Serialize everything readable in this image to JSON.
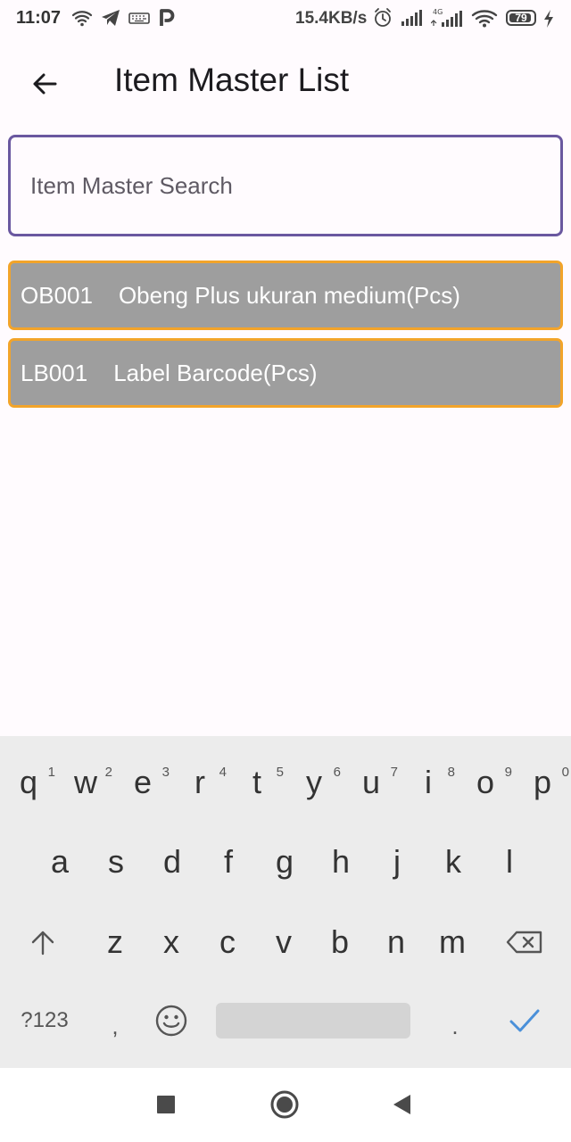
{
  "status_bar": {
    "time": "11:07",
    "network_speed": "15.4KB/s",
    "battery": "79",
    "icons": [
      "wifi-icon",
      "telegram-icon",
      "keyboard-icon",
      "parking-app-icon",
      "alarm-icon",
      "signal-icon",
      "signal-4g-icon",
      "wifi-icon",
      "battery-icon",
      "charging-icon"
    ]
  },
  "app_bar": {
    "title": "Item Master List",
    "back_icon": "arrow-left-icon"
  },
  "search": {
    "placeholder": "Item Master Search",
    "value": ""
  },
  "items": [
    {
      "code": "OB001",
      "name": "Obeng Plus ukuran medium(Pcs)"
    },
    {
      "code": "LB001",
      "name": "Label Barcode(Pcs)"
    }
  ],
  "keyboard": {
    "row1": [
      {
        "k": "q",
        "h": "1"
      },
      {
        "k": "w",
        "h": "2"
      },
      {
        "k": "e",
        "h": "3"
      },
      {
        "k": "r",
        "h": "4"
      },
      {
        "k": "t",
        "h": "5"
      },
      {
        "k": "y",
        "h": "6"
      },
      {
        "k": "u",
        "h": "7"
      },
      {
        "k": "i",
        "h": "8"
      },
      {
        "k": "o",
        "h": "9"
      },
      {
        "k": "p",
        "h": "0"
      }
    ],
    "row2": [
      "a",
      "s",
      "d",
      "f",
      "g",
      "h",
      "j",
      "k",
      "l"
    ],
    "row3": [
      "z",
      "x",
      "c",
      "v",
      "b",
      "n",
      "m"
    ],
    "symbols_label": "?123",
    "comma": ",",
    "period": "."
  },
  "colors": {
    "accent": "#6a58a0",
    "item_border": "#f2a42a",
    "item_bg": "#9e9e9e",
    "check": "#4a90d9"
  }
}
